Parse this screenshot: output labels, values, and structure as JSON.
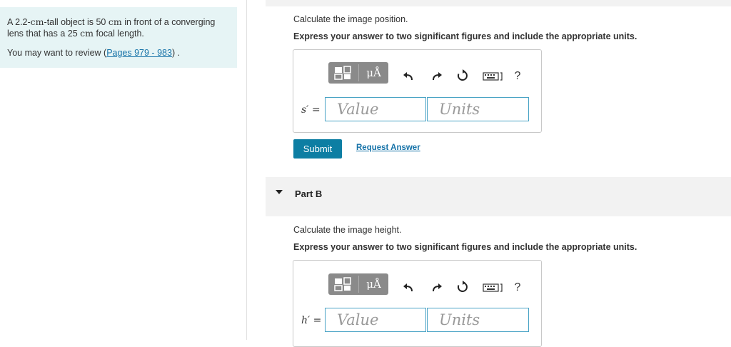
{
  "problem": {
    "text_1": "A 2.2-",
    "unit_cm_1": "cm",
    "text_2": "-tall object is 50 ",
    "unit_cm_2": "cm",
    "text_3": " in front of a converging lens that has a 25 ",
    "unit_cm_3": "cm",
    "text_4": " focal length.",
    "review_prefix": "You may want to review (",
    "review_link": "Pages 979 - 983",
    "review_suffix": ") ."
  },
  "part_a": {
    "prompt": "Calculate the image position.",
    "instruction": "Express your answer to two significant figures and include the appropriate units.",
    "variable_label": "s′ =",
    "value_placeholder": "Value",
    "units_placeholder": "Units",
    "mu_symbol": "μÅ",
    "help_symbol": "?",
    "submit_label": "Submit",
    "request_answer_label": "Request Answer"
  },
  "part_b": {
    "title": "Part B",
    "prompt": "Calculate the image height.",
    "instruction": "Express your answer to two significant figures and include the appropriate units.",
    "variable_label": "h′ =",
    "value_placeholder": "Value",
    "units_placeholder": "Units",
    "mu_symbol": "μÅ",
    "help_symbol": "?"
  },
  "colors": {
    "accent": "#0d7ea3",
    "link": "#1572a8",
    "panel_bg": "#e6f4f5",
    "field_border": "#4aa3c5"
  },
  "icons": [
    "templates-icon",
    "units-mu-icon",
    "undo-icon",
    "redo-icon",
    "reset-icon",
    "keyboard-icon",
    "help-icon",
    "caret-down-icon"
  ]
}
